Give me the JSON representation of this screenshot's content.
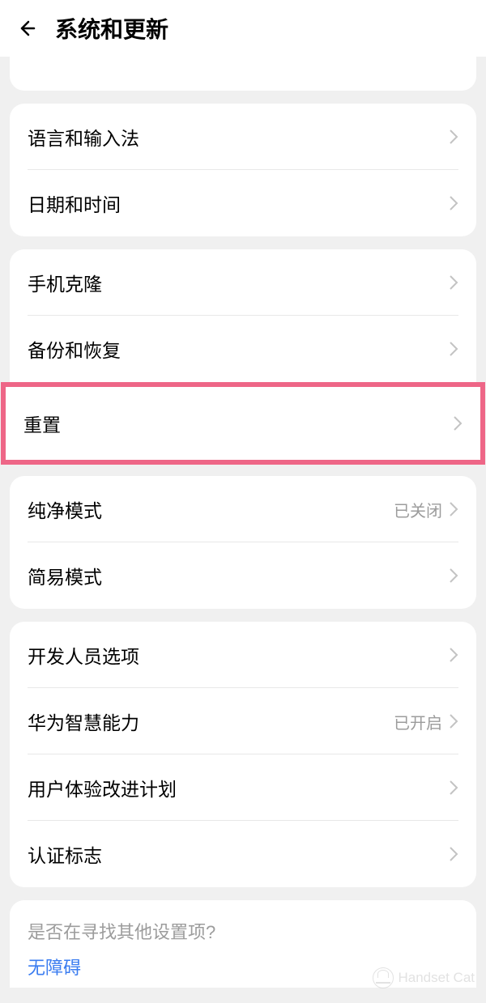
{
  "header": {
    "title": "系统和更新"
  },
  "groups": [
    {
      "id": "lang-time",
      "items": [
        {
          "key": "language-input",
          "label": "语言和输入法"
        },
        {
          "key": "date-time",
          "label": "日期和时间"
        }
      ]
    },
    {
      "id": "clone-backup",
      "items": [
        {
          "key": "phone-clone",
          "label": "手机克隆"
        },
        {
          "key": "backup-restore",
          "label": "备份和恢复"
        }
      ]
    }
  ],
  "highlighted": {
    "key": "reset",
    "label": "重置"
  },
  "group_modes": {
    "items": [
      {
        "key": "pure-mode",
        "label": "纯净模式",
        "value": "已关闭"
      },
      {
        "key": "simple-mode",
        "label": "简易模式"
      }
    ]
  },
  "group_dev": {
    "items": [
      {
        "key": "developer-options",
        "label": "开发人员选项"
      },
      {
        "key": "huawei-ai",
        "label": "华为智慧能力",
        "value": "已开启"
      },
      {
        "key": "ux-improvement",
        "label": "用户体验改进计划"
      },
      {
        "key": "cert-mark",
        "label": "认证标志"
      }
    ]
  },
  "search": {
    "prompt": "是否在寻找其他设置项?",
    "link": "无障碍"
  },
  "watermark": {
    "text": "Handset Cat"
  }
}
